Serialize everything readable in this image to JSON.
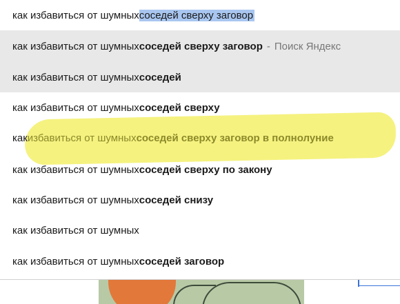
{
  "search": {
    "query_prefix": "как избавиться от шумных ",
    "query_selected": "соседей сверху заговор"
  },
  "suggestions": [
    {
      "prefix": "как избавиться от шумных ",
      "bold": "соседей сверху заговор",
      "suffix": "Поиск Яндекс",
      "separator": "-",
      "highlighted": true
    },
    {
      "prefix": "как избавиться от шумных ",
      "bold": "соседей",
      "highlighted": true
    },
    {
      "prefix": "как избавиться от шумных ",
      "bold": "соседей сверху"
    },
    {
      "prefix_first": "как ",
      "prefix_rest": "избавиться от шумных ",
      "bold": "соседей сверху заговор в полнолуние",
      "marker_color": "#f3f06a"
    },
    {
      "prefix": "как избавиться от шумных ",
      "bold": "соседей сверху по закону"
    },
    {
      "prefix": "как избавиться от шумных ",
      "bold": "соседей снизу"
    },
    {
      "prefix": "как избавиться от шумных",
      "bold": ""
    },
    {
      "prefix": "как избавиться от шумных ",
      "bold": "соседей заговор"
    }
  ],
  "colors": {
    "selection": "#a8c6f0",
    "hover_row": "#e8e8e8",
    "marker": "#f3f06a",
    "accent": "#3a72d8"
  }
}
